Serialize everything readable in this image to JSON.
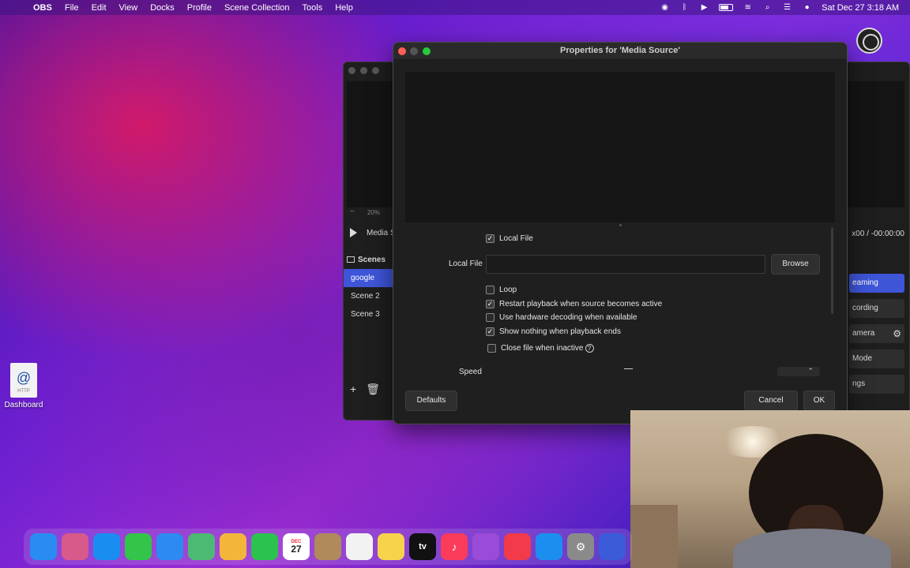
{
  "menubar": {
    "app_name": "OBS",
    "items": [
      "File",
      "Edit",
      "View",
      "Docks",
      "Profile",
      "Scene Collection",
      "Tools",
      "Help"
    ],
    "datetime": "Sat Dec 27  3:18 AM"
  },
  "desktop": {
    "icon_label": "Dashboard",
    "icon_glyph": "@",
    "icon_subtext": "HTTP"
  },
  "main_window": {
    "zoom_label": "20%",
    "media_label": "Media S",
    "timecode": "x00  /  -00:00:00",
    "scenes_title": "Scenes",
    "scenes": [
      "google",
      "Scene 2",
      "Scene 3"
    ],
    "controls": [
      "eaming",
      "cording",
      "amera",
      "Mode",
      "ngs"
    ]
  },
  "dialog": {
    "title": "Properties for 'Media Source'",
    "local_file_checkbox": "Local File",
    "local_file_label": "Local File",
    "local_file_value": "",
    "browse": "Browse",
    "loop": "Loop",
    "restart": "Restart playback when source becomes active",
    "hw_decoding": "Use hardware decoding when available",
    "show_nothing": "Show nothing when playback ends",
    "close_inactive": "Close file when inactive",
    "speed_label": "Speed",
    "defaults": "Defaults",
    "cancel": "Cancel",
    "ok": "OK"
  },
  "checkbox_states": {
    "local_file": true,
    "loop": false,
    "restart": true,
    "hw_decoding": false,
    "show_nothing": true,
    "close_inactive": false
  },
  "dock": {
    "calendar_month": "DEC",
    "calendar_day": "27",
    "tv_label": "tv"
  },
  "colors": {
    "accent": "#3e55d8",
    "traffic_close": "#ff5f57",
    "traffic_max": "#28c840"
  }
}
